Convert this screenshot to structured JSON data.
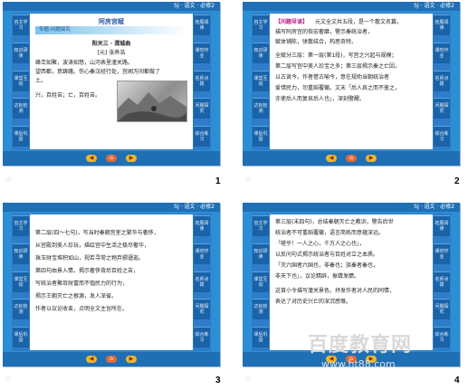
{
  "header_label": "SJ · 语文 · 必修2",
  "sidebar_left": [
    "自主学习",
    "知识研读",
    "课堂互动",
    "达标检测",
    "课后巩固"
  ],
  "sidebar_right": [
    "拓展阅读",
    "课时作业",
    "名师点拨",
    "问题探究",
    "综合练习"
  ],
  "nav_buttons": [
    "◀",
    "⌂",
    "▶"
  ],
  "slides": [
    {
      "page": "1",
      "title": "阿房宫赋",
      "band": "专题·问题探究",
      "subtitle": "阳关三 · 渭城曲",
      "subtitle2": "[元] 张养浩",
      "lines": [
        "峰峦如聚，波涛如怒，山河表里潼关路。",
        "望西都，意踌躇。伤心秦汉经行处，宫阙万间都做了",
        "土。",
        "兴，百姓苦；亡，百姓苦。"
      ]
    },
    {
      "page": "2",
      "tag": "【问题导读】",
      "lines": [
        "元文全文共五段，是一个散文名篇，",
        "描写阿房宫的恢宏奢靡，警示秦统治者，",
        "赋体铺陈，骈散结合，构思奇特。",
        "全赋分三层：第一层(第1段)，写宫之兴起与规模；",
        "第二层写宫中美人珍宝之多；第三层揭示秦之亡因，",
        "以古讽今。作者借古喻今，意在规劝当朝统治者",
        "爱惜民力，勿重蹈覆辙。文末「后人哀之而不鉴之，",
        "亦使后人而复哀后人也」，深刻警醒。"
      ]
    },
    {
      "page": "3",
      "lines": [
        "第二层(四～七句)，写当时秦朝宫室之繁华与奢侈，",
        "从宫殿到美人珍玩，描绘宫中生活之极尽奢华，",
        "珠玉财宝堆积如山，视若寻常之物弃掷逦迤。",
        "第四句由景入情，揭示奢侈背后百姓之苦，",
        "写统治者聚敛财富而不恤民力的行为，",
        "揭示王朝灭亡之根源，发人深省。",
        "作者以议论收束，点明全文主旨所在。"
      ]
    },
    {
      "page": "4",
      "lines": [
        "第三层(末四句)，总结秦朝灭亡之教训，警告后世",
        "统治者不可重蹈覆辙，语言简练而意蕴深远。",
        "「嗟乎！一人之心，千万人之心也」，",
        "以反问句式揭示统治者与百姓对立之本质。",
        "「灭六国者六国也，非秦也；族秦者秦也，",
        "非天下也」，议论精辟，振聋发聩。",
        "这首小令描写潼关景色，抒发作者对人民的同情，",
        "表达了对历史兴亡的深沉感慨。"
      ]
    }
  ],
  "watermark": {
    "brand": "百度教育网",
    "url": "www.ht88.com"
  }
}
